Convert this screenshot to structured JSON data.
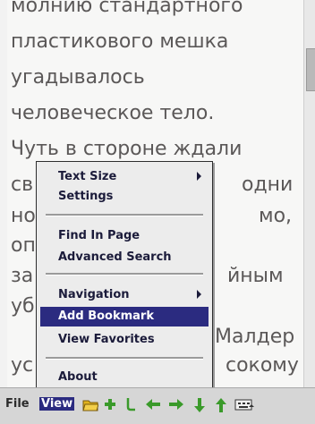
{
  "document": {
    "lines": [
      "молнию стандартного",
      "пластикового мешка",
      "угадывалось",
      "человеческое тело.",
      "Чуть в стороне ждали",
      "св",
      "но",
      "оп",
      "за",
      "уб",
      "ус"
    ],
    "right_fragments": {
      "odni": "одни",
      "mo": "мо,",
      "ynym": "йным",
      "malder": "Малдер",
      "sokomu": "сокому"
    }
  },
  "menubar": {
    "file_label": "File",
    "view_label": "View"
  },
  "view_menu": {
    "items": [
      {
        "label": "Text Size",
        "has_submenu": true
      },
      {
        "label": "Settings",
        "has_submenu": false
      },
      {
        "label": "Find In Page",
        "has_submenu": false
      },
      {
        "label": "Advanced Search",
        "has_submenu": false
      },
      {
        "label": "Navigation",
        "has_submenu": true
      },
      {
        "label": "Add Bookmark",
        "has_submenu": false,
        "selected": true
      },
      {
        "label": "View Favorites",
        "has_submenu": false
      },
      {
        "label": "About",
        "has_submenu": false
      }
    ]
  },
  "toolbar_icons": [
    "open-folder-icon",
    "add-plus-icon",
    "hook-icon",
    "arrow-left-icon",
    "arrow-right-icon",
    "arrow-down-icon",
    "arrow-up-icon",
    "keyboard-icon"
  ],
  "colors": {
    "text": "#5b5858",
    "menu_selected_bg": "#2b2b80",
    "menu_text": "#1b1b3a",
    "icon_green": "#3a9a2a",
    "icon_orange": "#e08a1e"
  }
}
